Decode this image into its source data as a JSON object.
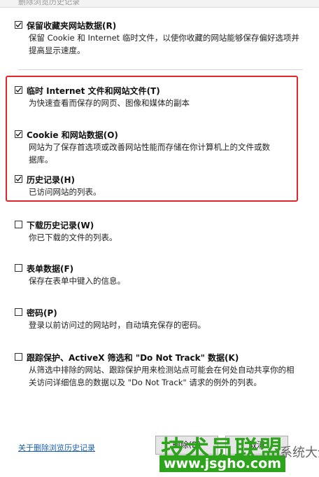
{
  "window_title": "删除浏览历史记录",
  "options": [
    {
      "label": "保留收藏夹网站数据(R)",
      "checked": true,
      "desc_lines": [
        "保留 Cookie 和 Internet 临时文件，以使你收藏的网站能够保存偏好选项并",
        "提高显示速度。"
      ]
    },
    {
      "label": "临时 Internet 文件和网站文件(T)",
      "checked": true,
      "desc_lines": [
        "为快速查看而保存的网页、图像和媒体的副本"
      ]
    },
    {
      "label": "Cookie 和网站数据(O)",
      "checked": true,
      "desc_lines": [
        "网站为了保存首选项或改善网站性能而存储在你计算机上的文件或数",
        "据库。"
      ]
    },
    {
      "label": "历史记录(H)",
      "checked": true,
      "desc_lines": [
        "已访问网站的列表。"
      ]
    },
    {
      "label": "下载历史记录(W)",
      "checked": false,
      "desc_lines": [
        "你已下载的文件的列表。"
      ]
    },
    {
      "label": "表单数据(F)",
      "checked": false,
      "desc_lines": [
        "保存在表单中键入的信息。"
      ]
    },
    {
      "label": "密码(P)",
      "checked": false,
      "desc_lines": [
        "登录以前访问过的网站时，自动填充保存的密码。"
      ]
    },
    {
      "label": "跟踪保护、ActiveX 筛选和 \"Do Not Track\" 数据(K)",
      "checked": false,
      "desc_lines": [
        "从筛选中排除的网站、跟踪保护用来检测站点可能会在何处自动共享你的相",
        "关访问详细信息的数据以及 \"Do Not Track\" 请求的例外的列表。"
      ]
    }
  ],
  "footer": {
    "link": "关于删除浏览历史记录",
    "delete_button": "删除(D)",
    "cancel_button": "取消"
  },
  "watermark": {
    "title": "技术员联盟",
    "url": "www.jsgho.com",
    "side_text": "系统大全"
  },
  "colors": {
    "highlight": "#e0262b",
    "link": "#1a5fb4",
    "watermark_green": "#2ea41d"
  }
}
